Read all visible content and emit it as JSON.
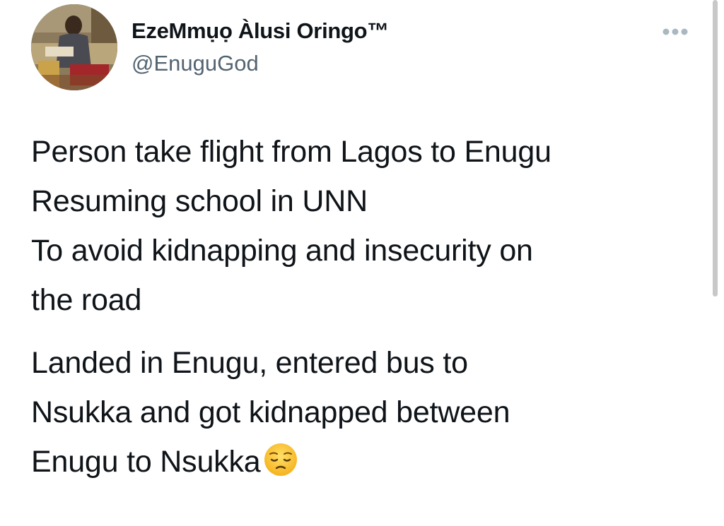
{
  "author": {
    "display_name": "EzeMmụọ Àlusi Oringo™",
    "handle": "@EnuguGod"
  },
  "tweet": {
    "paragraph1": [
      "Person take flight from Lagos to Enugu",
      "Resuming school in UNN",
      "To avoid kidnapping and insecurity on",
      "the road"
    ],
    "paragraph2": [
      "Landed in Enugu, entered bus to",
      "Nsukka and got kidnapped between",
      "Enugu to Nsukka"
    ],
    "trailing_emoji": "pensive-face-icon"
  },
  "icons": {
    "more": "more-options-icon"
  },
  "colors": {
    "text_primary": "#0f1419",
    "text_secondary": "#536471",
    "more_dots": "#aab8c2"
  }
}
